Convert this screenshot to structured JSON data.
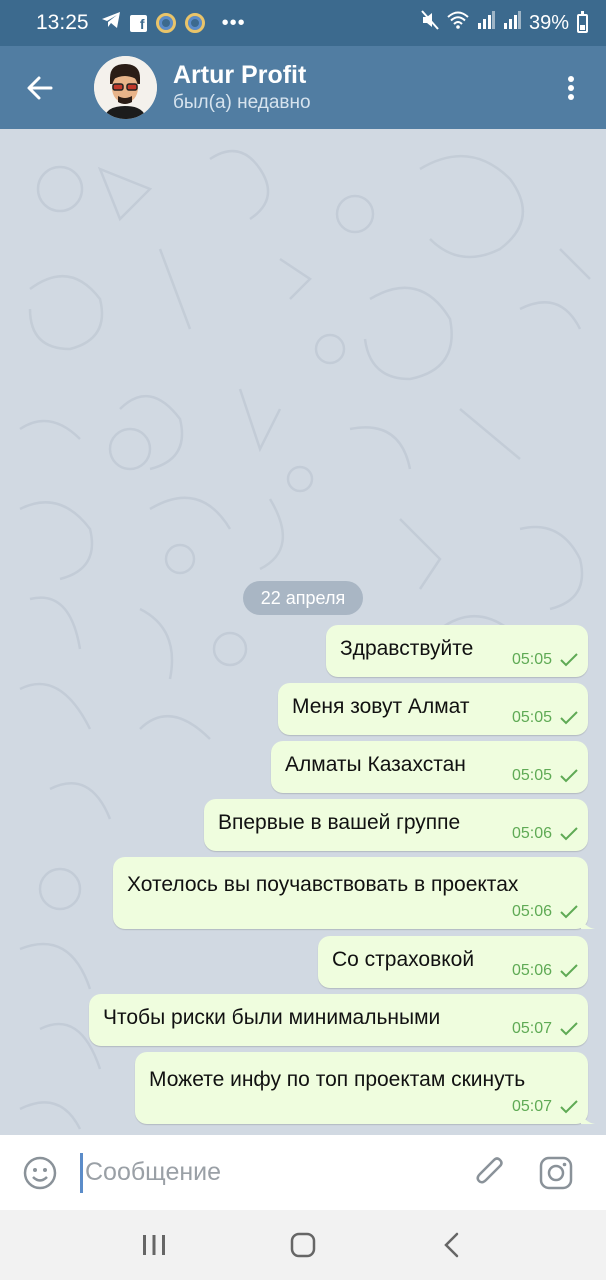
{
  "status_bar": {
    "time": "13:25",
    "battery": "39%",
    "icons": [
      "telegram-icon",
      "facebook-icon",
      "ring-app-icon",
      "ring-app-icon",
      "more-dots-icon",
      "mute-icon",
      "wifi-icon",
      "signal-icon",
      "signal-icon",
      "battery-icon"
    ]
  },
  "header": {
    "title": "Artur Profit",
    "status": "был(а) недавно",
    "color": "#517da2"
  },
  "chat": {
    "date": "22 апреля",
    "messages": [
      {
        "text": "Здравствуйте",
        "time": "05:05",
        "read": true
      },
      {
        "text": "Меня зовут Алмат",
        "time": "05:05",
        "read": true
      },
      {
        "text": "Алматы Казахстан",
        "time": "05:05",
        "read": true
      },
      {
        "text": "Впервые в вашей группе",
        "time": "05:06",
        "read": true
      },
      {
        "text": "Хотелось вы поучавствовать в проектах",
        "time": "05:06",
        "read": true
      },
      {
        "text": "Со страховкой",
        "time": "05:06",
        "read": true
      },
      {
        "text": "Чтобы риски были минимальными",
        "time": "05:07",
        "read": true
      },
      {
        "text": "Можете инфу по топ проектам скинуть",
        "time": "05:07",
        "read": true
      }
    ],
    "bubble_color": "#effdde",
    "check_color": "#5faa55"
  },
  "input": {
    "placeholder": "Сообщение",
    "value": ""
  }
}
